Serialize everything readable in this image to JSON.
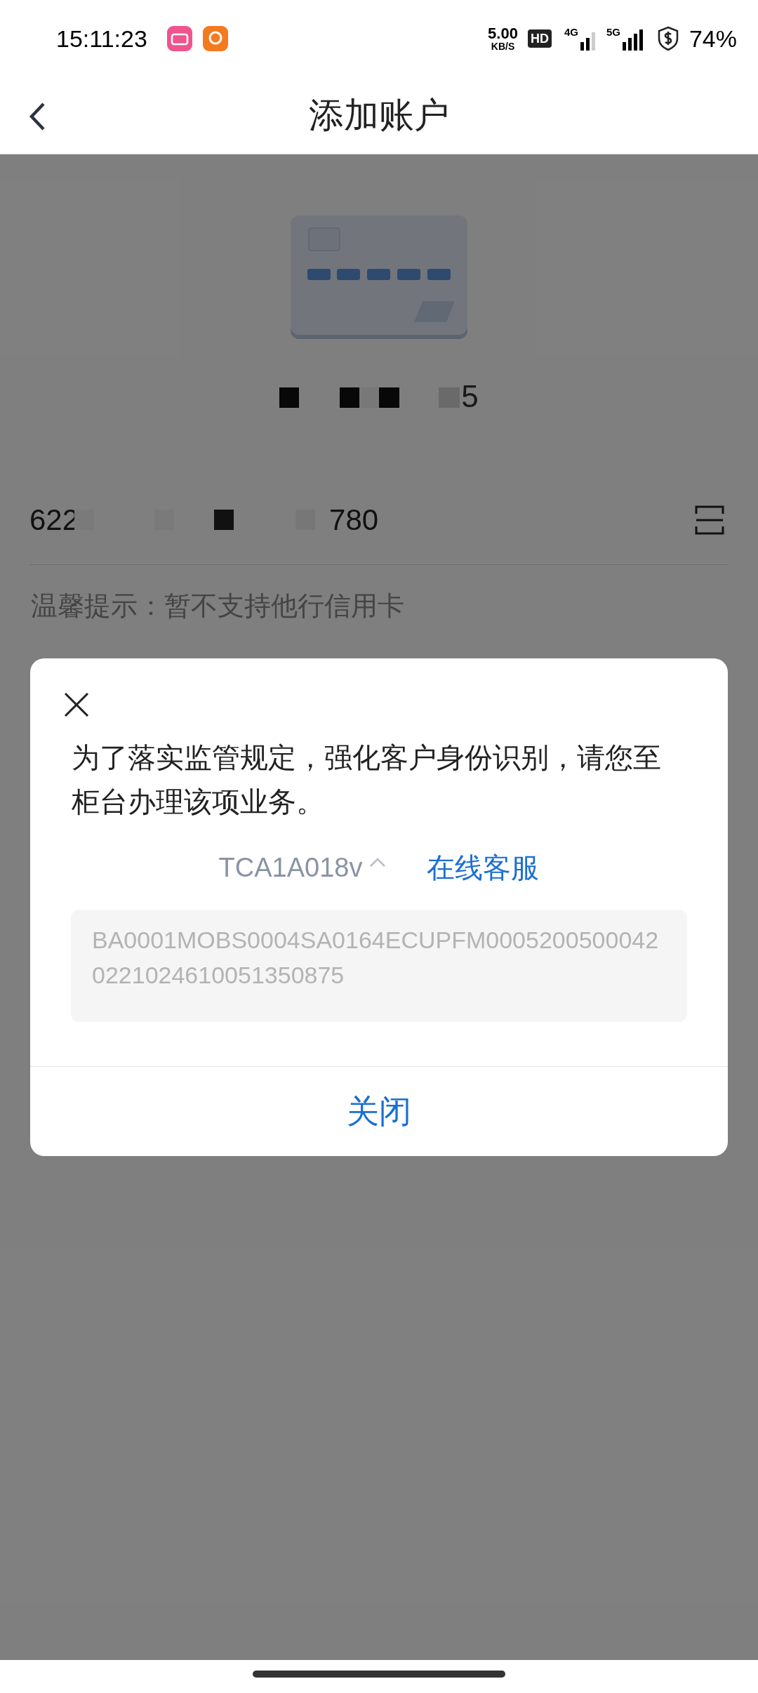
{
  "status_bar": {
    "time": "15:11:23",
    "net_speed": "5.00",
    "net_speed_unit": "KB/S",
    "hd_badge": "HD",
    "signal_1": "4G",
    "signal_2": "5G",
    "battery": "74%"
  },
  "nav": {
    "title": "添加账户"
  },
  "card": {
    "masked_name": "5"
  },
  "account": {
    "number_start": "622",
    "number_end": "780"
  },
  "tip": "温馨提示：暂不支持他行信用卡",
  "dialog": {
    "message": "为了落实监管规定，强化客户身份识别，请您至柜台办理该项业务。",
    "code": "TCA1A018v",
    "expanded": true,
    "service_link": "在线客服",
    "trace": "BA0001MOBS0004SA0164ECUPFM00052005000420221024610051350875",
    "close_button": "关闭"
  }
}
